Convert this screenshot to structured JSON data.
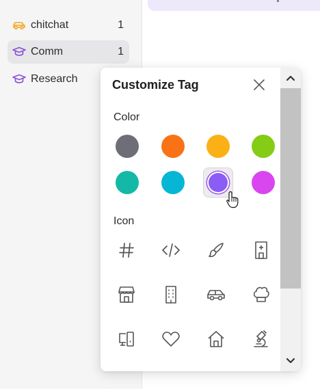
{
  "sidebar": {
    "items": [
      {
        "label": "chitchat",
        "count": "1",
        "icon": "car-icon",
        "color": "#f4a623"
      },
      {
        "label": "Comm",
        "count": "1",
        "icon": "graduation-cap-icon",
        "color": "#8a4fd8"
      },
      {
        "label": "Research",
        "count": "",
        "icon": "graduation-cap-icon",
        "color": "#8a4fd8"
      }
    ]
  },
  "dialog": {
    "title": "Customize Tag",
    "color_label": "Color",
    "icon_label": "Icon",
    "colors": [
      "#6e6e78",
      "#f97316",
      "#fbb016",
      "#84cc16",
      "#14b8a6",
      "#06b6d4",
      "#8b5cf6",
      "#d946ef"
    ],
    "selected_color_index": 6,
    "icons": [
      "hash-icon",
      "code-icon",
      "brush-icon",
      "hospital-icon",
      "store-icon",
      "building-icon",
      "car-icon",
      "chef-hat-icon",
      "devices-icon",
      "heart-icon",
      "home-icon",
      "microscope-icon"
    ]
  }
}
